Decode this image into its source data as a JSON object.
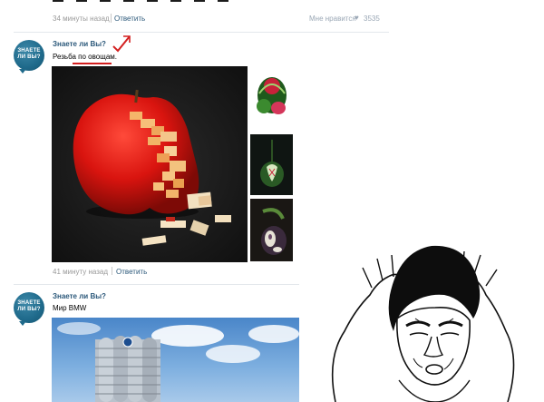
{
  "previous_post": {
    "time": "34 минуты назад",
    "reply_label": "Ответить",
    "like_label": "Мне нравится",
    "like_count": "3535"
  },
  "post1": {
    "avatar_text": "ЗНАЕТЕ ЛИ ВЫ?",
    "author": "Знаете ли Вы?",
    "text_prefix": "Резьба по ",
    "text_highlight": "овощам",
    "text_suffix": ".",
    "time": "41 минуту назад",
    "reply_label": "Ответить"
  },
  "post2": {
    "avatar_text": "ЗНАЕТЕ ЛИ ВЫ?",
    "author": "Знаете ли Вы?",
    "text": "Мир BMW"
  },
  "colors": {
    "link": "#2b587a",
    "meta": "#999999",
    "highlight_underline": "#d31f1f",
    "avatar": "#1f6a8b"
  },
  "icons": [
    "heart-icon",
    "red-checkmark-icon"
  ]
}
